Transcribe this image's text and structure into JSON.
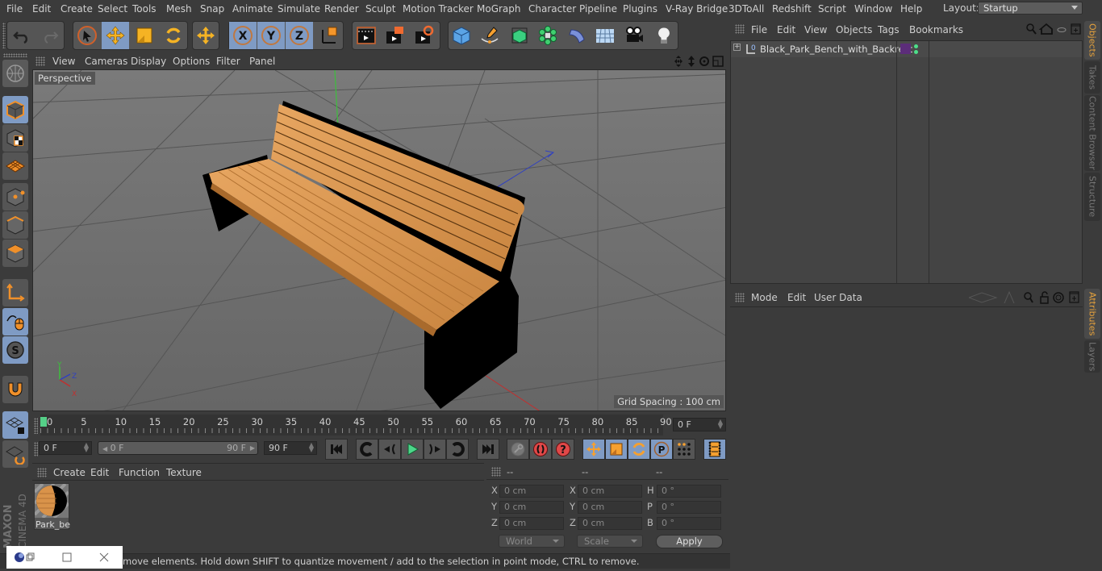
{
  "menubar": {
    "items": [
      "File",
      "Edit",
      "Create",
      "Select",
      "Tools",
      "Mesh",
      "Snap",
      "Animate",
      "Simulate",
      "Render",
      "Sculpt",
      "Motion Tracker",
      "MoGraph",
      "Character",
      "Pipeline",
      "Plugins",
      "V-Ray Bridge",
      "3DToAll",
      "Redshift",
      "Script",
      "Window",
      "Help"
    ],
    "layout_label": "Layout:",
    "layout_value": "Startup"
  },
  "toolbar": {
    "icons": [
      "undo-icon",
      "redo-icon",
      "select-arrow-icon",
      "move-icon",
      "scale-icon",
      "rotate-icon",
      "transform-icon",
      "x-axis-icon",
      "y-axis-icon",
      "z-axis-icon",
      "world-coordinates-icon",
      "render-view-icon",
      "render-picture-viewer-icon",
      "render-settings-icon",
      "cube-icon",
      "pen-spline-icon",
      "subdivision-icon",
      "mograph-cloner-icon",
      "deformer-bend-icon",
      "floor-icon",
      "camera-icon",
      "light-icon"
    ]
  },
  "viewport": {
    "menu": [
      "View",
      "Cameras",
      "Display",
      "Options",
      "Filter",
      "Panel"
    ],
    "camera_label": "Perspective",
    "grid_spacing": "Grid Spacing : 100 cm",
    "axis_labels": {
      "x": "X",
      "y": "Y",
      "z": "Z"
    }
  },
  "timeline": {
    "ticks": [
      "0",
      "5",
      "10",
      "15",
      "20",
      "25",
      "30",
      "35",
      "40",
      "45",
      "50",
      "55",
      "60",
      "65",
      "70",
      "75",
      "80",
      "85",
      "90"
    ],
    "current_frame": "0 F",
    "start_field": "0 F",
    "range_start": "0 F",
    "range_end": "90 F",
    "end_field": "90 F"
  },
  "materials": {
    "menu": [
      "Create",
      "Edit",
      "Function",
      "Texture"
    ],
    "items": [
      {
        "name": "Park_be"
      }
    ]
  },
  "coordinates": {
    "headers": [
      "--",
      "--",
      "--"
    ],
    "rows": [
      {
        "l1": "X",
        "v1": "0 cm",
        "l2": "X",
        "v2": "0 cm",
        "l3": "H",
        "v3": "0 °"
      },
      {
        "l1": "Y",
        "v1": "0 cm",
        "l2": "Y",
        "v2": "0 cm",
        "l3": "P",
        "v3": "0 °"
      },
      {
        "l1": "Z",
        "v1": "0 cm",
        "l2": "Z",
        "v2": "0 cm",
        "l3": "B",
        "v3": "0 °"
      }
    ],
    "coord_system": "World",
    "mode": "Scale",
    "apply_label": "Apply"
  },
  "status": {
    "text": "move elements. Hold down SHIFT to quantize movement / add to the selection in point mode, CTRL to remove."
  },
  "objects_panel": {
    "menu": [
      "File",
      "Edit",
      "View",
      "Objects",
      "Tags",
      "Bookmarks"
    ],
    "objects": [
      {
        "name": "Black_Park_Bench_with_Backrest",
        "tag_color": "#5c2d7a"
      }
    ]
  },
  "attributes_panel": {
    "menu": [
      "Mode",
      "Edit",
      "User Data"
    ]
  },
  "side_tabs": {
    "top": [
      "Objects",
      "Takes",
      "Content Browser",
      "Structure"
    ],
    "bottom": [
      "Attributes",
      "Layers"
    ]
  },
  "branding": {
    "vendor": "MAXON",
    "product": "CINEMA 4D"
  },
  "colors": {
    "accent": "#e8a33c",
    "active_button": "#7f9bc4",
    "viewport_bg": "#6e6e6e",
    "wood": "#d9934a"
  }
}
